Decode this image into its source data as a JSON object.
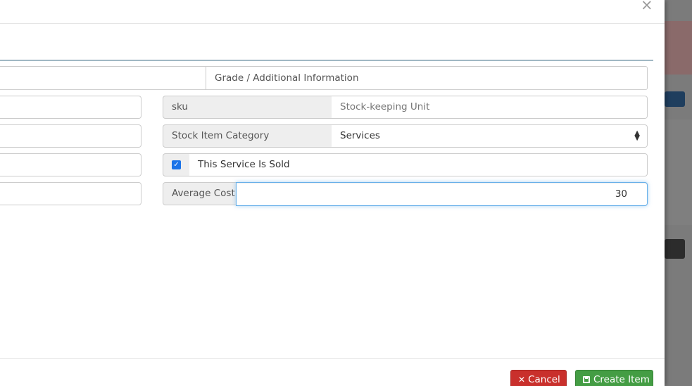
{
  "dialog": {
    "close_symbol": "×",
    "grade_label": "Grade / Additional Information"
  },
  "form": {
    "sku": {
      "label": "sku",
      "placeholder": "Stock-keeping Unit"
    },
    "category": {
      "label": "Stock Item Category",
      "value": "Services"
    },
    "is_sold": {
      "label": "This Service Is Sold",
      "checked": true
    },
    "average_cost": {
      "label": "Average Cost",
      "value": "30"
    }
  },
  "footer": {
    "cancel_label": "Cancel",
    "create_label": "Create Item"
  },
  "colors": {
    "cancel": "#c9302c",
    "create": "#449d44",
    "accent_line": "#2b5f7a",
    "focus": "#66afe9"
  }
}
